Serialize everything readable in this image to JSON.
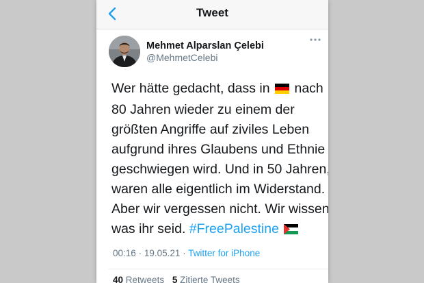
{
  "header": {
    "title": "Tweet",
    "back_icon": "chevron-left-icon"
  },
  "tweet": {
    "author_name": "Mehmet Alparslan Çelebi",
    "author_handle": "@MehmetCelebi",
    "more_icon": "more-horizontal-icon",
    "lines": {
      "l1a": "Wer hätte gedacht, dass in",
      "flag_de": "german-flag-icon",
      "l1b": "nach",
      "l2": "80 Jahren wieder zu einem der",
      "l3": "größten Angriffe auf ziviles Leben",
      "l4": "aufgrund ihres Glaubens und Ethnie",
      "l5": "geschwiegen wird. Und in 50 Jahren,",
      "l6": "waren alle eigentlich im Widerstand.",
      "l7": "Aber wir vergessen nicht. Wir wissen",
      "l8a": "was ihr seid.",
      "hashtag": "#FreePalestine",
      "flag_ps": "palestinian-flag-icon"
    },
    "time": "00:16",
    "date": "19.05.21",
    "separator": "·",
    "source": "Twitter for iPhone"
  },
  "stats": {
    "retweets_count": "40",
    "retweets_label": "Retweets",
    "quotes_count": "5",
    "quotes_label": "Zitierte Tweets"
  },
  "colors": {
    "accent": "#1da1f2",
    "text": "#14171a",
    "muted": "#657786"
  }
}
